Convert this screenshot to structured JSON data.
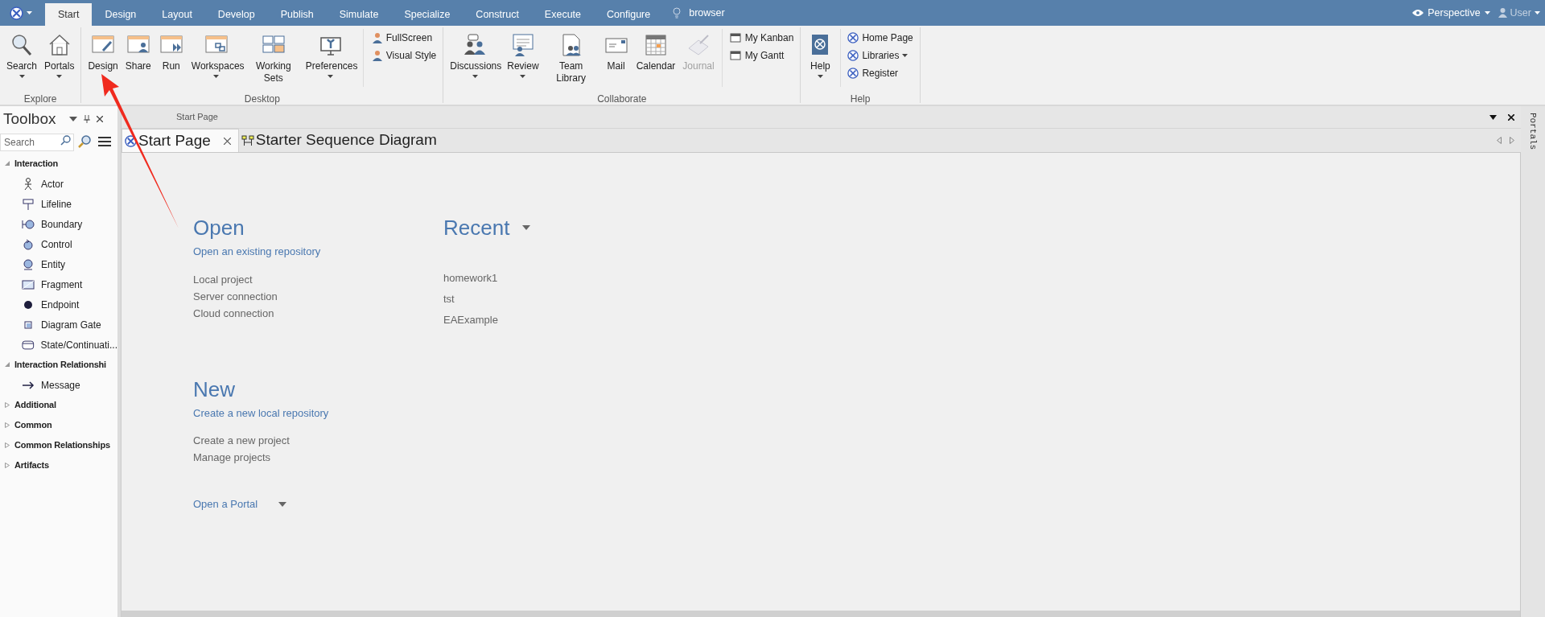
{
  "title_bar": {
    "tabs": [
      {
        "label": "Start",
        "selected": true
      },
      {
        "label": "Design",
        "selected": false
      },
      {
        "label": "Layout",
        "selected": false
      },
      {
        "label": "Develop",
        "selected": false
      },
      {
        "label": "Publish",
        "selected": false
      },
      {
        "label": "Simulate",
        "selected": false
      },
      {
        "label": "Specialize",
        "selected": false
      },
      {
        "label": "Construct",
        "selected": false
      },
      {
        "label": "Execute",
        "selected": false
      },
      {
        "label": "Configure",
        "selected": false
      }
    ],
    "search_text": "browser",
    "perspective": "Perspective",
    "user": "User"
  },
  "ribbon": {
    "groups": [
      {
        "label": "Explore",
        "items": [
          {
            "kind": "large",
            "label": "Search",
            "dropdown": true,
            "disabled": false
          },
          {
            "kind": "large",
            "label": "Portals",
            "dropdown": true,
            "disabled": false
          }
        ]
      },
      {
        "label": "Desktop",
        "items": [
          {
            "kind": "large",
            "label": "Design",
            "dropdown": false,
            "disabled": false
          },
          {
            "kind": "large",
            "label": "Share",
            "dropdown": false,
            "disabled": false
          },
          {
            "kind": "large",
            "label": "Run",
            "dropdown": false,
            "disabled": false
          },
          {
            "kind": "large",
            "label": "Workspaces",
            "dropdown": true,
            "disabled": false
          },
          {
            "kind": "large",
            "label": "Working Sets",
            "dropdown": false,
            "disabled": false
          },
          {
            "kind": "large",
            "label": "Preferences",
            "dropdown": true,
            "disabled": false
          },
          {
            "kind": "small",
            "label": "FullScreen",
            "dropdown": false,
            "disabled": false
          },
          {
            "kind": "small",
            "label": "Visual Style",
            "dropdown": false,
            "disabled": false
          }
        ]
      },
      {
        "label": "Collaborate",
        "items": [
          {
            "kind": "large",
            "label": "Discussions",
            "dropdown": true,
            "disabled": false
          },
          {
            "kind": "large",
            "label": "Review",
            "dropdown": true,
            "disabled": false
          },
          {
            "kind": "large",
            "label": "Team Library",
            "dropdown": false,
            "disabled": false
          },
          {
            "kind": "large",
            "label": "Mail",
            "dropdown": false,
            "disabled": false
          },
          {
            "kind": "large",
            "label": "Calendar",
            "dropdown": false,
            "disabled": false
          },
          {
            "kind": "large",
            "label": "Journal",
            "dropdown": false,
            "disabled": true
          },
          {
            "kind": "small",
            "label": "My Kanban",
            "dropdown": false,
            "disabled": false
          },
          {
            "kind": "small",
            "label": "My Gantt",
            "dropdown": false,
            "disabled": false
          }
        ]
      },
      {
        "label": "Help",
        "items": [
          {
            "kind": "large",
            "label": "Help",
            "dropdown": true,
            "disabled": false
          },
          {
            "kind": "small",
            "label": "Home Page",
            "dropdown": false,
            "disabled": false
          },
          {
            "kind": "small",
            "label": "Libraries",
            "dropdown": true,
            "disabled": false
          },
          {
            "kind": "small",
            "label": "Register",
            "dropdown": false,
            "disabled": false
          }
        ]
      }
    ]
  },
  "toolbox": {
    "title": "Toolbox",
    "search_placeholder": "Search",
    "sections": [
      {
        "label": "Interaction",
        "expanded": true,
        "items": [
          "Actor",
          "Lifeline",
          "Boundary",
          "Control",
          "Entity",
          "Fragment",
          "Endpoint",
          "Diagram Gate",
          "State/Continuati..."
        ]
      },
      {
        "label": "Interaction Relationshi",
        "expanded": true,
        "items": [
          "Message"
        ]
      },
      {
        "label": "Additional",
        "expanded": false
      },
      {
        "label": "Common",
        "expanded": false
      },
      {
        "label": "Common Relationships",
        "expanded": false
      },
      {
        "label": "Artifacts",
        "expanded": false
      }
    ]
  },
  "document": {
    "pane_title": "Start Page",
    "tabs": [
      {
        "label": "Start Page",
        "selected": true
      },
      {
        "label": "Starter Sequence Diagram",
        "selected": false
      }
    ],
    "open": {
      "heading": "Open",
      "subheading": "Open an existing repository",
      "links": [
        "Local project",
        "Server connection",
        "Cloud connection"
      ]
    },
    "recent": {
      "heading": "Recent",
      "items": [
        "homework1",
        "tst",
        "EAExample"
      ]
    },
    "new": {
      "heading": "New",
      "subheading": "Create a new local repository",
      "links": [
        "Create a new project",
        "Manage projects"
      ]
    },
    "portal": "Open a Portal"
  },
  "side_strip": {
    "label": "Portals"
  }
}
